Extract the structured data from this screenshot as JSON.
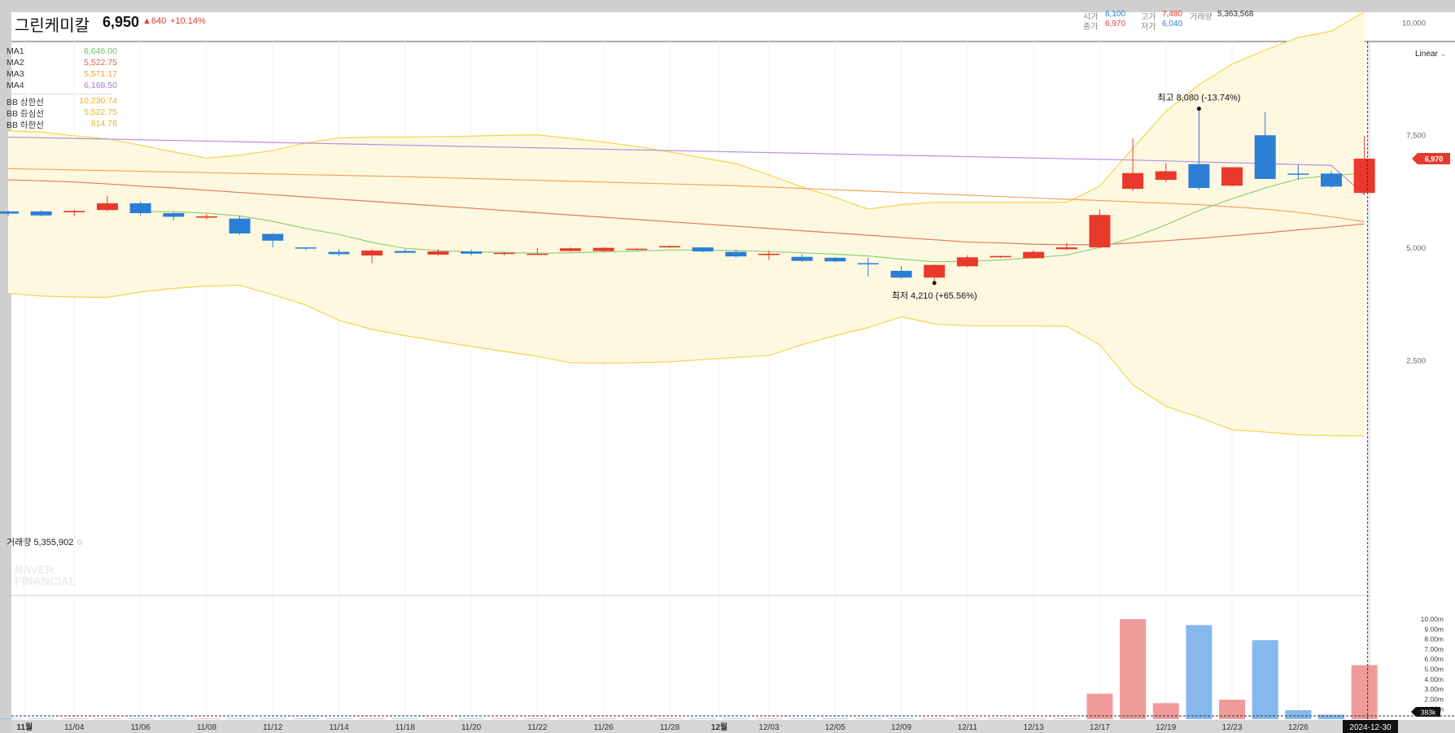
{
  "header": {
    "name": "그린케미칼",
    "price": "6,950",
    "change": "▲640",
    "change_pct": "+10.14%",
    "open_label": "시가",
    "open": "6,100",
    "high_label": "고가",
    "high": "7,480",
    "close_label": "종가",
    "close": "6,970",
    "low_label": "저가",
    "low": "6,040",
    "volume_label": "거래량",
    "volume": "5,363,568"
  },
  "legend": {
    "ma": [
      {
        "label": "MA1",
        "value": "6,646.00",
        "color": "#6bbf59"
      },
      {
        "label": "MA2",
        "value": "5,522.75",
        "color": "#e0604e"
      },
      {
        "label": "MA3",
        "value": "5,571.17",
        "color": "#f29a3f"
      },
      {
        "label": "MA4",
        "value": "6,168.50",
        "color": "#a478d4"
      }
    ],
    "bb": [
      {
        "label": "BB 상한선",
        "value": "10,230.74",
        "color": "#f2c230"
      },
      {
        "label": "BB 중심선",
        "value": "5,522.75",
        "color": "#f2c230"
      },
      {
        "label": "BB 하한선",
        "value": "814.76",
        "color": "#f2c230"
      }
    ]
  },
  "scale_mode": "Linear",
  "watermark": [
    "NAVER",
    "FINANCIAL"
  ],
  "volume_panel": {
    "label": "거래량",
    "value": "5,355,902",
    "current_tag": "383k",
    "ticks": [
      "10.00m",
      "9.00m",
      "8.00m",
      "7.00m",
      "6.00m",
      "5.00m",
      "4.00m",
      "3.00m",
      "2.00m",
      "1.00m"
    ]
  },
  "chart_data": {
    "type": "candlestick",
    "colors": {
      "up": "#e8392c",
      "down": "#2a7fd4",
      "vol_up": "#f09a9a",
      "vol_down": "#86b8ee",
      "band": "#fff8e1"
    },
    "price_ticks": [
      "10,000",
      "7,500",
      "5,000",
      "2,500"
    ],
    "price_tick_values": [
      10000,
      7500,
      5000,
      2500
    ],
    "current_price_tag": "6,970",
    "current_price": 6970,
    "x_labels": [
      "11월",
      "11/04",
      "11/06",
      "11/08",
      "11/12",
      "11/14",
      "11/18",
      "11/20",
      "11/22",
      "11/26",
      "11/28",
      "12월",
      "12/03",
      "12/05",
      "12/09",
      "12/11",
      "12/13",
      "12/17",
      "12/19",
      "12/23",
      "12/26"
    ],
    "x_label_index": [
      0.5,
      2,
      4,
      6,
      8,
      10,
      12,
      14,
      16,
      18,
      20,
      21.5,
      23,
      25,
      27,
      29,
      31,
      33,
      35,
      37,
      39
    ],
    "crosshair_date": "2024-12-30",
    "annotations": [
      {
        "text": "최고 8,080 (-13.74%)",
        "index": 36,
        "value": 8080,
        "side": "above"
      },
      {
        "text": "최저 4,210 (+65.56%)",
        "index": 28,
        "value": 4210,
        "side": "below"
      }
    ],
    "candles": [
      [
        5800,
        5820,
        5700,
        5750
      ],
      [
        5800,
        5820,
        5690,
        5710
      ],
      [
        5780,
        5830,
        5700,
        5810
      ],
      [
        5830,
        6150,
        5800,
        5980
      ],
      [
        5980,
        6020,
        5700,
        5760
      ],
      [
        5760,
        5780,
        5600,
        5680
      ],
      [
        5660,
        5740,
        5620,
        5690
      ],
      [
        5640,
        5700,
        5280,
        5310
      ],
      [
        5300,
        5320,
        5000,
        5150
      ],
      [
        5000,
        5000,
        4940,
        4980
      ],
      [
        4900,
        4960,
        4800,
        4850
      ],
      [
        4820,
        4960,
        4650,
        4930
      ],
      [
        4920,
        4960,
        4880,
        4880
      ],
      [
        4840,
        4960,
        4820,
        4910
      ],
      [
        4910,
        4950,
        4820,
        4860
      ],
      [
        4860,
        4900,
        4820,
        4880
      ],
      [
        4860,
        4990,
        4840,
        4860
      ],
      [
        4920,
        5000,
        4900,
        4980
      ],
      [
        4920,
        5010,
        4900,
        4990
      ],
      [
        4960,
        4990,
        4940,
        4970
      ],
      [
        5000,
        5040,
        4990,
        5030
      ],
      [
        5000,
        5000,
        4890,
        4910
      ],
      [
        4900,
        4950,
        4780,
        4800
      ],
      [
        4830,
        4930,
        4720,
        4860
      ],
      [
        4790,
        4850,
        4680,
        4700
      ],
      [
        4770,
        4780,
        4670,
        4690
      ],
      [
        4650,
        4770,
        4350,
        4630
      ],
      [
        4480,
        4590,
        4300,
        4330
      ],
      [
        4330,
        4620,
        4210,
        4610
      ],
      [
        4580,
        4830,
        4560,
        4780
      ],
      [
        4780,
        4820,
        4770,
        4810
      ],
      [
        4760,
        4940,
        4750,
        4900
      ],
      [
        4960,
        5100,
        4940,
        5000
      ],
      [
        5000,
        5840,
        4980,
        5720
      ],
      [
        6300,
        7420,
        6250,
        6650
      ],
      [
        6500,
        6870,
        6450,
        6690
      ],
      [
        6850,
        8080,
        6280,
        6320
      ],
      [
        6370,
        6740,
        6350,
        6780
      ],
      [
        7490,
        8000,
        6520,
        6520
      ],
      [
        6640,
        6830,
        6500,
        6620
      ],
      [
        6640,
        6700,
        6320,
        6350
      ],
      [
        6210,
        7480,
        6160,
        6970
      ]
    ],
    "ma1": [
      null,
      null,
      null,
      null,
      5800,
      5790,
      5760,
      5700,
      5580,
      5420,
      5290,
      5110,
      4980,
      4930,
      4900,
      4890,
      4870,
      4880,
      4900,
      4920,
      4940,
      4940,
      4930,
      4910,
      4880,
      4850,
      4810,
      4740,
      4680,
      4690,
      4720,
      4770,
      4830,
      5000,
      5220,
      5500,
      5820,
      6080,
      6320,
      6520,
      6600,
      6646
    ],
    "ma2": [
      6500,
      6480,
      6450,
      6410,
      6360,
      6320,
      6270,
      6220,
      6170,
      6120,
      6070,
      6020,
      5970,
      5920,
      5870,
      5820,
      5770,
      5720,
      5670,
      5620,
      5570,
      5520,
      5470,
      5420,
      5370,
      5320,
      5270,
      5220,
      5170,
      5120,
      5100,
      5070,
      5060,
      5060,
      5100,
      5150,
      5200,
      5260,
      5320,
      5390,
      5450,
      5522.75
    ],
    "ma3": [
      6750,
      6735,
      6720,
      6705,
      6690,
      6675,
      6660,
      6645,
      6630,
      6615,
      6600,
      6585,
      6570,
      6550,
      6530,
      6510,
      6490,
      6470,
      6450,
      6430,
      6410,
      6390,
      6370,
      6340,
      6310,
      6280,
      6250,
      6220,
      6190,
      6160,
      6130,
      6100,
      6070,
      6040,
      6010,
      5980,
      5950,
      5900,
      5850,
      5780,
      5680,
      5571.17
    ],
    "ma4": [
      7450,
      7435,
      7420,
      7405,
      7390,
      7375,
      7360,
      7345,
      7330,
      7315,
      7300,
      7285,
      7270,
      7255,
      7240,
      7225,
      7210,
      7195,
      7180,
      7165,
      7150,
      7135,
      7120,
      7105,
      7090,
      7075,
      7060,
      7045,
      7030,
      7015,
      7000,
      6985,
      6970,
      6955,
      6940,
      6920,
      6900,
      6880,
      6860,
      6840,
      6820,
      6168.5
    ],
    "bb_upper": [
      7590,
      7560,
      7480,
      7410,
      7270,
      7120,
      6980,
      7050,
      7150,
      7320,
      7430,
      7450,
      7450,
      7460,
      7470,
      7490,
      7500,
      7420,
      7340,
      7240,
      7120,
      6990,
      6860,
      6610,
      6340,
      6110,
      5850,
      5950,
      6000,
      6000,
      6000,
      6000,
      6000,
      6360,
      7200,
      8020,
      8610,
      9070,
      9380,
      9660,
      9800,
      10230.74
    ],
    "bb_lower": [
      3980,
      3920,
      3900,
      3890,
      4010,
      4090,
      4140,
      4160,
      3950,
      3720,
      3380,
      3180,
      3040,
      2920,
      2800,
      2690,
      2580,
      2440,
      2430,
      2440,
      2460,
      2510,
      2560,
      2600,
      2840,
      3040,
      3220,
      3460,
      3300,
      3260,
      3260,
      3260,
      3250,
      2840,
      1950,
      1470,
      1230,
      950,
      900,
      840,
      820,
      814.76
    ],
    "volume": [
      0.05,
      0.05,
      0.05,
      0.05,
      0.05,
      0.05,
      0.05,
      0.05,
      0.05,
      0.05,
      0.05,
      0.05,
      0.05,
      0.05,
      0.05,
      0.05,
      0.05,
      0.05,
      0.05,
      0.05,
      0.05,
      0.05,
      0.05,
      0.05,
      0.05,
      0.05,
      0.05,
      0.05,
      0.05,
      0.05,
      0.05,
      0.05,
      0.05,
      2.55,
      10.0,
      1.6,
      9.4,
      1.95,
      7.9,
      0.9,
      0.45,
      5.4
    ]
  }
}
